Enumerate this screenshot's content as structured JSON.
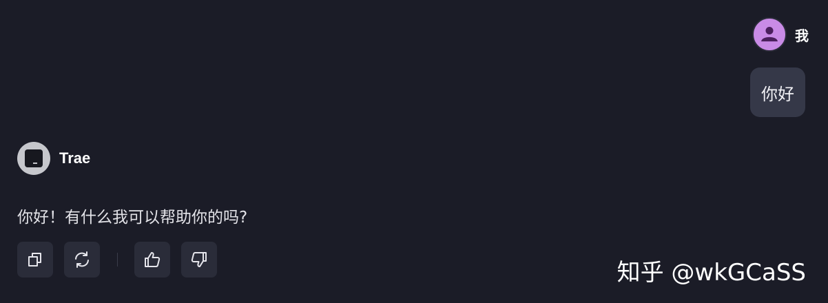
{
  "user": {
    "name": "我",
    "avatar_icon": "person-icon",
    "message": "你好"
  },
  "assistant": {
    "name": "Trae",
    "avatar_icon": "terminal-icon",
    "message": "你好！有什么我可以帮助你的吗?"
  },
  "actions": {
    "copy_icon": "copy-icon",
    "regenerate_icon": "refresh-icon",
    "like_icon": "thumbs-up-icon",
    "dislike_icon": "thumbs-down-icon"
  },
  "watermark": "知乎 @wkGCaSS",
  "colors": {
    "background": "#1b1c27",
    "user_bubble": "#353848",
    "user_avatar": "#c98be6",
    "action_button": "#2a2c39"
  }
}
